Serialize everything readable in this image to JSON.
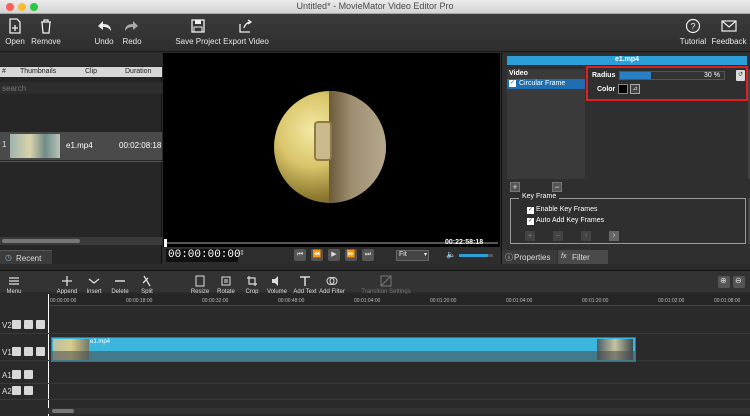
{
  "window": {
    "title": "Untitled* - MovieMator Video Editor Pro"
  },
  "toolbar": {
    "open": "Open",
    "remove": "Remove",
    "undo": "Undo",
    "redo": "Redo",
    "save_project": "Save Project",
    "export_video": "Export Video",
    "tutorial": "Tutorial",
    "feedback": "Feedback"
  },
  "clips": {
    "search_placeholder": "search",
    "headers": [
      "#",
      "Thumbnails",
      "Clip",
      "Duration"
    ],
    "rows": [
      {
        "num": "1",
        "clip": "e1.mp4",
        "duration": "00:02:08:18"
      }
    ],
    "recent_tab": "Recent"
  },
  "preview": {
    "timecode": "00:00:00:00",
    "duration": "00:22:58:18",
    "zoom": "Fit",
    "volume_level": 0.85
  },
  "filters": {
    "clip_name": "e1.mp4",
    "category": "Video",
    "applied": [
      "Circular Frame"
    ],
    "radius_label": "Radius",
    "radius_value": "30 %",
    "radius_fill": 0.3,
    "color_label": "Color",
    "keyframe_title": "Key Frame",
    "enable_keyframes": "Enable Key Frames",
    "auto_add_keyframes": "Auto Add Key Frames",
    "properties_tab": "Properties",
    "filter_tab": "Filter"
  },
  "timeline": {
    "tools": [
      "Menu",
      "Append",
      "Insert",
      "Delete",
      "Split",
      "Resize",
      "Rotate",
      "Crop",
      "Volume",
      "Add Text",
      "Add Filter",
      "Transition Settings"
    ],
    "ticks": [
      "00:00:00:00",
      "00:00:18:00",
      "00:00:32:00",
      "00:00:48:00",
      "00:01:04:00",
      "00:01:20:00",
      "00:01:04:00",
      "00:01:20:00",
      "00:01:02:00",
      "00:01:08:00"
    ],
    "tracks": [
      "V2",
      "V1",
      "A1",
      "A2"
    ],
    "clip_label": "e1.mp4"
  },
  "colors": {
    "accent": "#2a9fd8",
    "highlight_box": "#e02020",
    "clip_fill": "#3cb6dc"
  }
}
